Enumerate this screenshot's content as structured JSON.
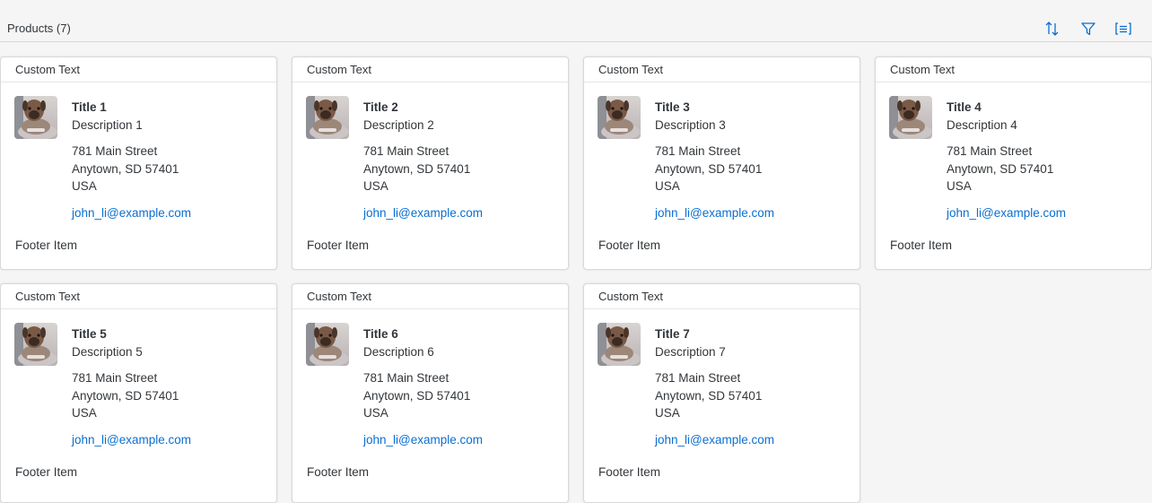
{
  "toolbar": {
    "title": "Products (7)",
    "icons": [
      "sort-icon",
      "filter-icon",
      "group-icon"
    ],
    "accent_color": "#0a6ed1"
  },
  "cards": [
    {
      "header": "Custom Text",
      "title": "Title 1",
      "description": "Description 1",
      "address_line1": "781 Main Street",
      "address_line2": "Anytown, SD 57401",
      "country": "USA",
      "email": "john_li@example.com",
      "footer": "Footer Item"
    },
    {
      "header": "Custom Text",
      "title": "Title 2",
      "description": "Description 2",
      "address_line1": "781 Main Street",
      "address_line2": "Anytown, SD 57401",
      "country": "USA",
      "email": "john_li@example.com",
      "footer": "Footer Item"
    },
    {
      "header": "Custom Text",
      "title": "Title 3",
      "description": "Description 3",
      "address_line1": "781 Main Street",
      "address_line2": "Anytown, SD 57401",
      "country": "USA",
      "email": "john_li@example.com",
      "footer": "Footer Item"
    },
    {
      "header": "Custom Text",
      "title": "Title 4",
      "description": "Description 4",
      "address_line1": "781 Main Street",
      "address_line2": "Anytown, SD 57401",
      "country": "USA",
      "email": "john_li@example.com",
      "footer": "Footer Item"
    },
    {
      "header": "Custom Text",
      "title": "Title 5",
      "description": "Description 5",
      "address_line1": "781 Main Street",
      "address_line2": "Anytown, SD 57401",
      "country": "USA",
      "email": "john_li@example.com",
      "footer": "Footer Item"
    },
    {
      "header": "Custom Text",
      "title": "Title 6",
      "description": "Description 6",
      "address_line1": "781 Main Street",
      "address_line2": "Anytown, SD 57401",
      "country": "USA",
      "email": "john_li@example.com",
      "footer": "Footer Item"
    },
    {
      "header": "Custom Text",
      "title": "Title 7",
      "description": "Description 7",
      "address_line1": "781 Main Street",
      "address_line2": "Anytown, SD 57401",
      "country": "USA",
      "email": "john_li@example.com",
      "footer": "Footer Item"
    }
  ]
}
